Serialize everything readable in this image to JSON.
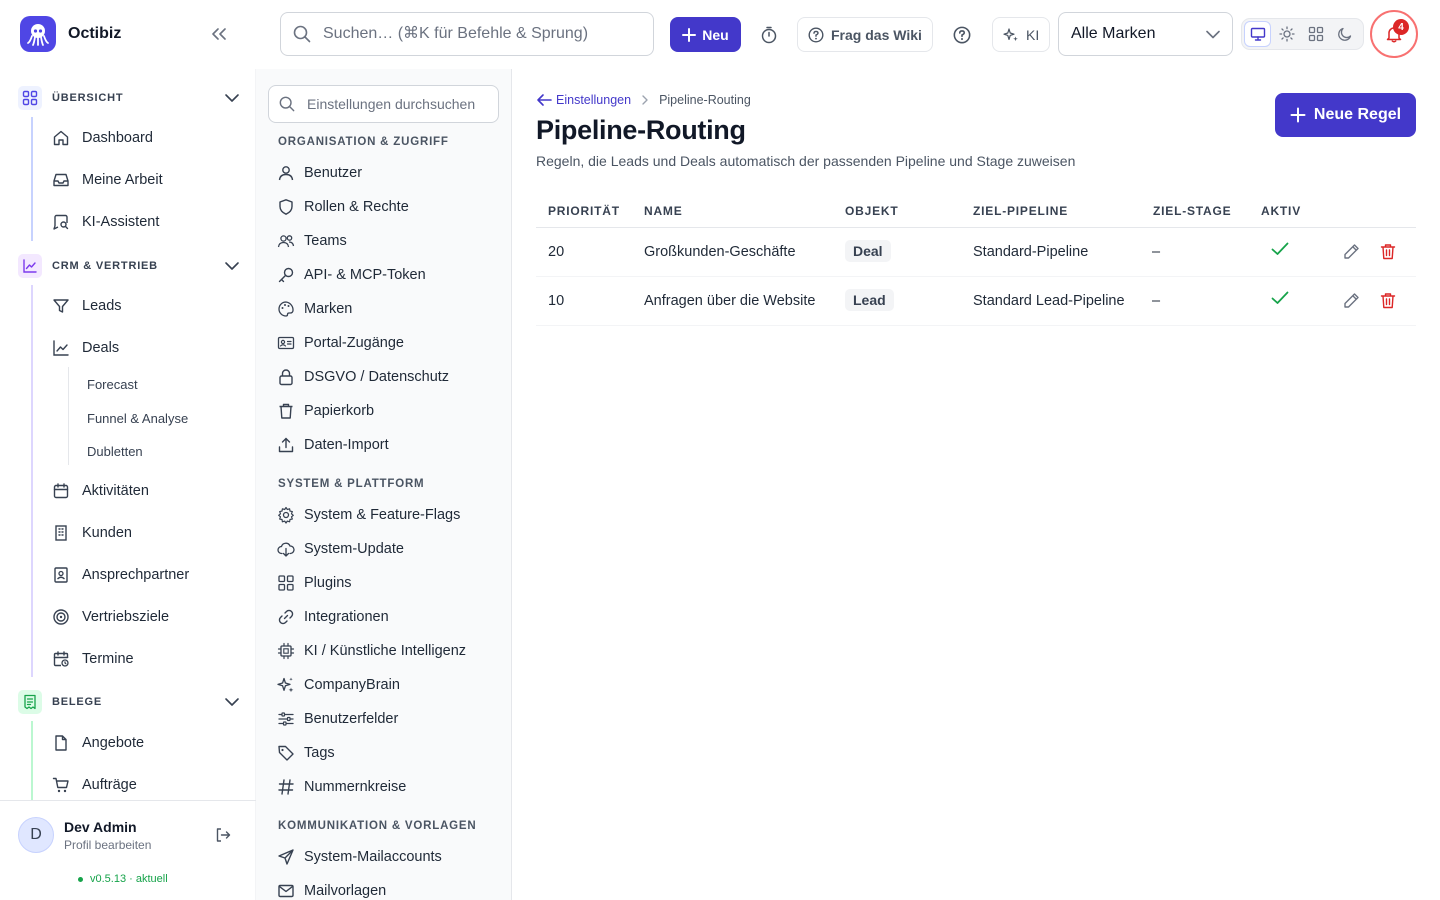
{
  "app": {
    "name": "Octibiz"
  },
  "topbar": {
    "search_placeholder": "Suchen… (⌘K für Befehle & Sprung)",
    "new_label": "Neu",
    "wiki_label": "Frag das Wiki",
    "ai_label": "KI",
    "brand_filter": "Alle Marken",
    "notification_count": "4"
  },
  "sidebar": {
    "sections": [
      {
        "label": "ÜBERSICHT",
        "color": "#4f46e5",
        "items": [
          "Dashboard",
          "Meine Arbeit",
          "KI-Assistent"
        ]
      },
      {
        "label": "CRM & VERTRIEB",
        "color": "#7c3aed",
        "items": [
          "Leads",
          "Deals",
          "Aktivitäten",
          "Kunden",
          "Ansprechpartner",
          "Vertriebsziele",
          "Termine"
        ],
        "deal_subitems": [
          "Forecast",
          "Funnel & Analyse",
          "Dubletten"
        ]
      },
      {
        "label": "BELEGE",
        "color": "#16a34a",
        "items": [
          "Angebote",
          "Aufträge"
        ]
      }
    ],
    "profile": {
      "initial": "D",
      "name": "Dev Admin",
      "subtitle": "Profil bearbeiten"
    },
    "version": "v0.5.13 · aktuell"
  },
  "settings_nav": {
    "search_placeholder": "Einstellungen durchsuchen",
    "groups": [
      {
        "label": "ORGANISATION & ZUGRIFF",
        "items": [
          "Benutzer",
          "Rollen & Rechte",
          "Teams",
          "API- & MCP-Token",
          "Marken",
          "Portal-Zugänge",
          "DSGVO / Datenschutz",
          "Papierkorb",
          "Daten-Import"
        ]
      },
      {
        "label": "SYSTEM & PLATTFORM",
        "items": [
          "System & Feature-Flags",
          "System-Update",
          "Plugins",
          "Integrationen",
          "KI / Künstliche Intelligenz",
          "CompanyBrain",
          "Benutzerfelder",
          "Tags",
          "Nummernkreise"
        ]
      },
      {
        "label": "KOMMUNIKATION & VORLAGEN",
        "items": [
          "System-Mailaccounts",
          "Mailvorlagen"
        ]
      }
    ]
  },
  "page": {
    "breadcrumb_parent": "Einstellungen",
    "breadcrumb_current": "Pipeline-Routing",
    "title": "Pipeline-Routing",
    "subtitle": "Regeln, die Leads und Deals automatisch der passenden Pipeline und Stage zuweisen",
    "new_rule_label": "Neue Regel"
  },
  "table": {
    "headers": [
      "PRIORITÄT",
      "NAME",
      "OBJEKT",
      "ZIEL-PIPELINE",
      "ZIEL-STAGE",
      "AKTIV"
    ],
    "rows": [
      {
        "priority": "20",
        "name": "Großkunden-Geschäfte",
        "object": "Deal",
        "pipeline": "Standard-Pipeline",
        "stage": "–",
        "active": true
      },
      {
        "priority": "10",
        "name": "Anfragen über die Website",
        "object": "Lead",
        "pipeline": "Standard Lead-Pipeline",
        "stage": "–",
        "active": true
      }
    ]
  },
  "colors": {
    "primary": "#4338ca",
    "active": "#16a34a",
    "danger": "#dc2626"
  }
}
